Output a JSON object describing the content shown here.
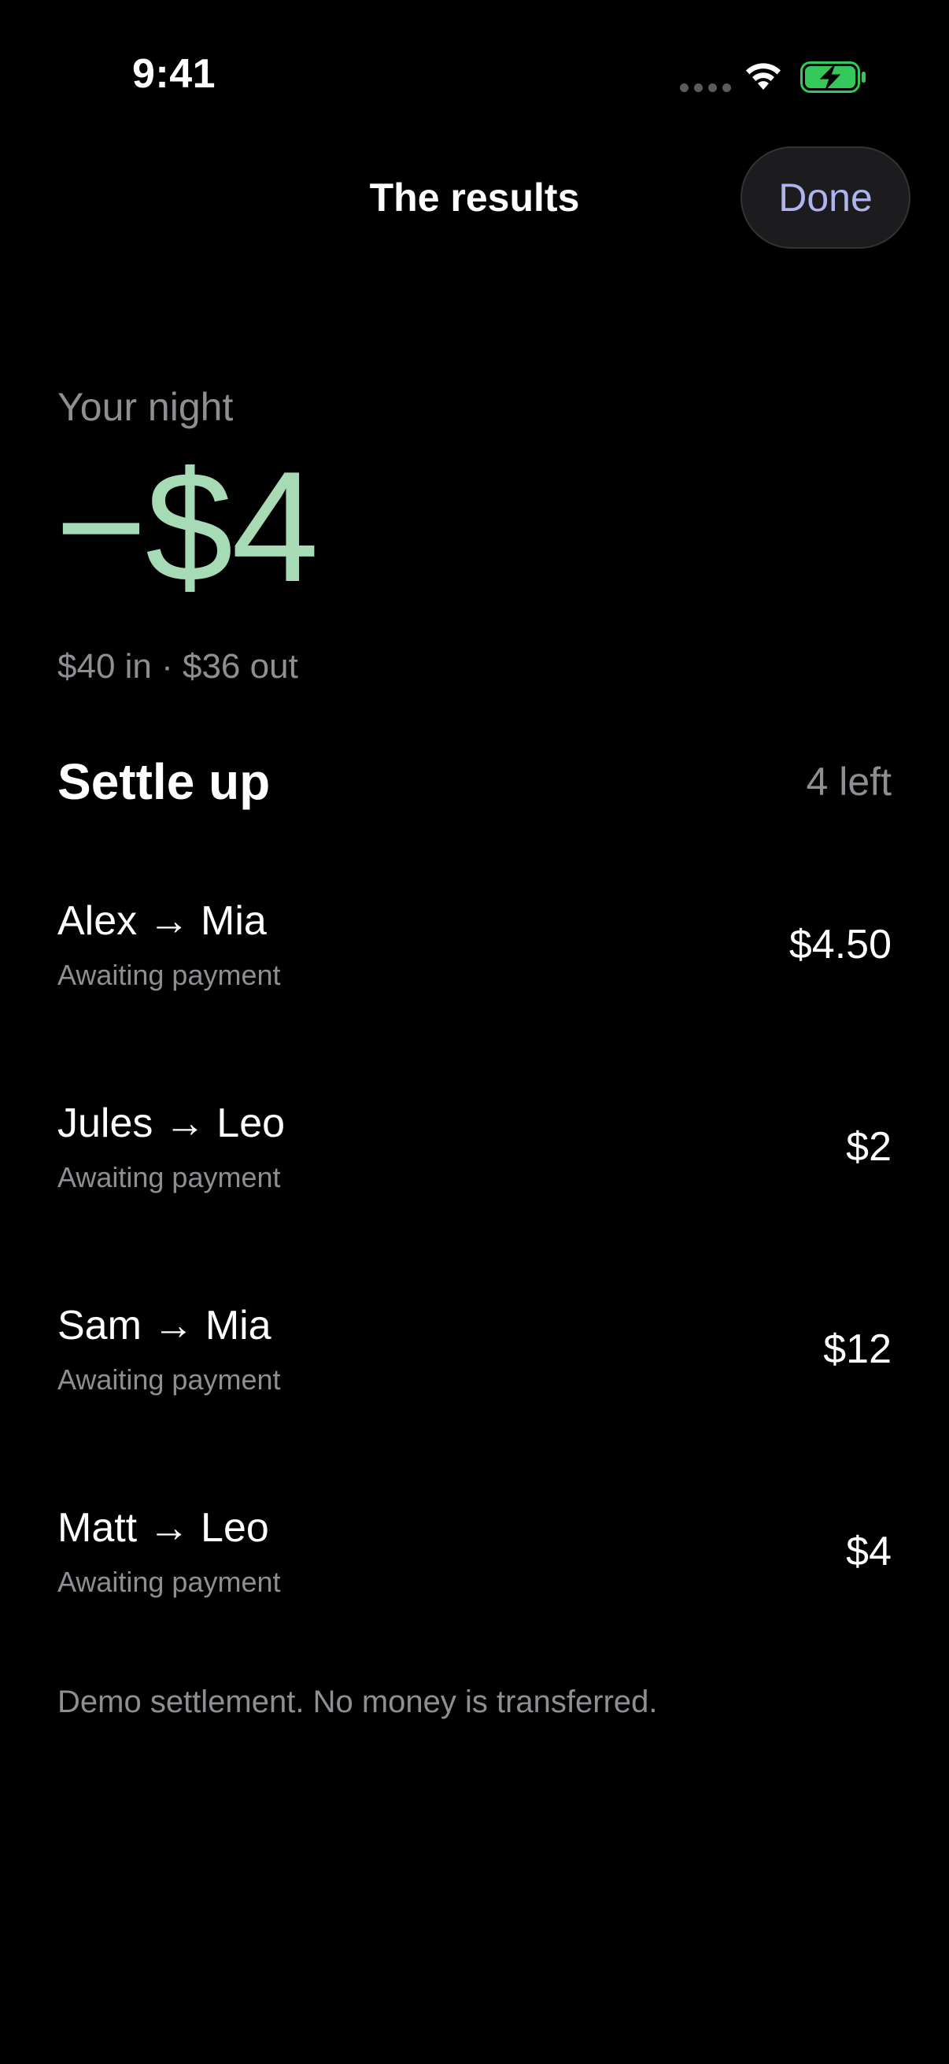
{
  "status_bar": {
    "time": "9:41",
    "signal_icon": "cellular-dots-icon",
    "wifi_icon": "wifi-icon",
    "battery_icon": "battery-charging-icon",
    "battery_color": "#34c759"
  },
  "nav": {
    "title": "The results",
    "done_label": "Done"
  },
  "summary": {
    "caption": "Your night",
    "amount": "−$4",
    "breakdown": "$40 in · $36 out",
    "accent_color": "#a6dbb6"
  },
  "settle": {
    "title": "Settle up",
    "count": "4 left",
    "rows": [
      {
        "pair": "Alex → Mia",
        "status": "Awaiting payment",
        "amount": "$4.50"
      },
      {
        "pair": "Jules → Leo",
        "status": "Awaiting payment",
        "amount": "$2"
      },
      {
        "pair": "Sam → Mia",
        "status": "Awaiting payment",
        "amount": "$12"
      },
      {
        "pair": "Matt → Leo",
        "status": "Awaiting payment",
        "amount": "$4"
      }
    ]
  },
  "footer": {
    "note": "Demo settlement. No money is transferred."
  }
}
